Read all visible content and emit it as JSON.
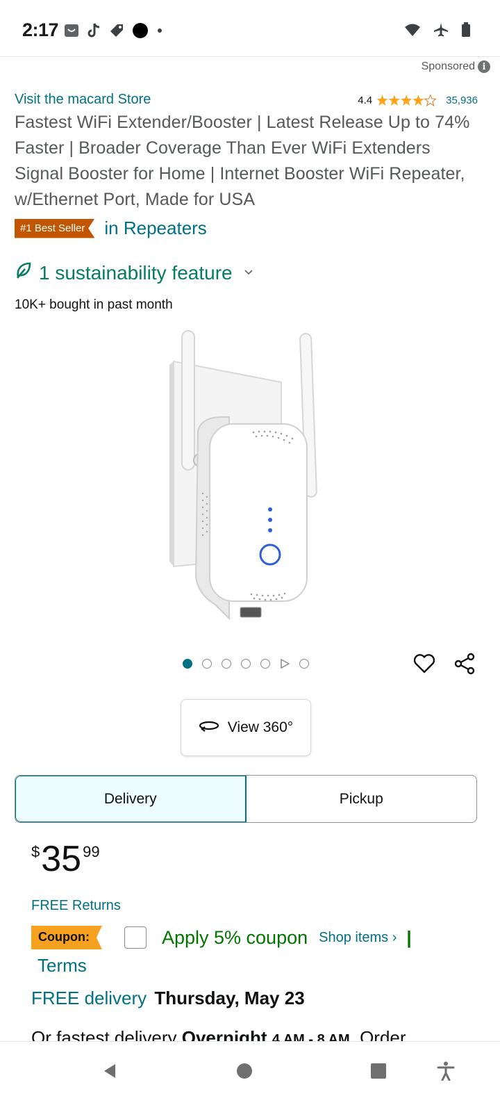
{
  "status_bar": {
    "time": "2:17",
    "left_icons": [
      "shop-icon",
      "tiktok-icon",
      "tag-icon",
      "dot-icon",
      "small-dot-icon"
    ],
    "right_icons": [
      "wifi-icon",
      "airplane-icon",
      "battery-icon"
    ]
  },
  "sponsored": {
    "label": "Sponsored"
  },
  "product": {
    "store_link": "Visit the macard Store",
    "rating": "4.4",
    "rating_count": "35,936",
    "title": "Fastest WiFi Extender/Booster | Latest Release Up to 74% Faster | Broader Coverage Than Ever WiFi Extenders Signal Booster for Home | Internet Booster WiFi Repeater, w/Ethernet Port, Made for USA",
    "best_seller_badge": "#1 Best Seller",
    "best_seller_category": "in Repeaters",
    "sustainability": "1 sustainability feature",
    "bought": "10K+ bought in past month",
    "image_count": 7,
    "active_image": 1
  },
  "actions": {
    "view_360": "View 360°"
  },
  "fulfillment": {
    "options": [
      "Delivery",
      "Pickup"
    ],
    "selected": "Delivery"
  },
  "price": {
    "symbol": "$",
    "whole": "35",
    "fraction": "99"
  },
  "returns": "FREE Returns",
  "coupon": {
    "badge": "Coupon:",
    "apply": "Apply 5% coupon",
    "shop_items": "Shop items ›",
    "separator": "|",
    "terms": "Terms"
  },
  "delivery": {
    "free_label": "FREE delivery",
    "date": "Thursday, May 23"
  },
  "fastest": {
    "prefix": "Or fastest delivery",
    "option": "Overnight",
    "window": "4 AM - 8 AM",
    "suffix": ". Order"
  },
  "colors": {
    "link": "#007185",
    "best_seller": "#c45500",
    "coupon": "#f7a11f",
    "sustain": "#067d62",
    "star": "#ffa41c",
    "apply": "#007600"
  }
}
